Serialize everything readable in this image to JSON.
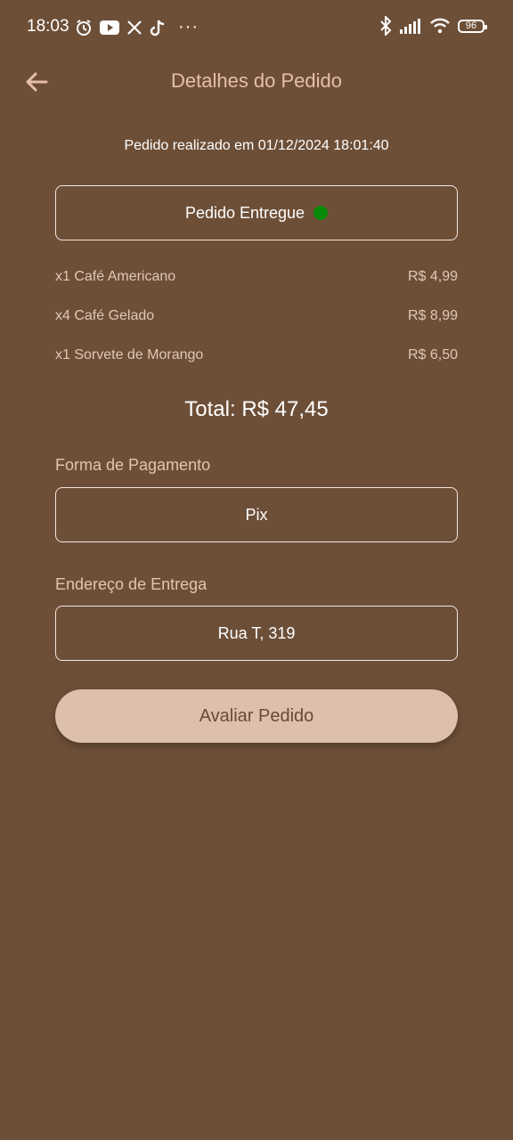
{
  "status_bar": {
    "time": "18:03",
    "left_icons": [
      "alarm-icon",
      "youtube-icon",
      "x-icon",
      "tiktok-icon"
    ],
    "more": "···",
    "right_icons": [
      "bluetooth-icon",
      "signal-icon",
      "wifi-icon"
    ],
    "battery": "96"
  },
  "header": {
    "title": "Detalhes do Pedido",
    "back_icon": "arrow-left-icon"
  },
  "order": {
    "date_text": "Pedido realizado em 01/12/2024 18:01:40",
    "status": "Pedido Entregue",
    "status_color": "#0a8a0a",
    "items": [
      {
        "label": "x1 Café Americano",
        "price": "R$ 4,99"
      },
      {
        "label": "x4 Café Gelado",
        "price": "R$ 8,99"
      },
      {
        "label": "x1 Sorvete de Morango",
        "price": "R$ 6,50"
      }
    ],
    "total": "Total: R$ 47,45"
  },
  "payment": {
    "label": "Forma de Pagamento",
    "value": "Pix"
  },
  "address": {
    "label": "Endereço de Entrega",
    "value": "Rua T, 319"
  },
  "actions": {
    "rate_label": "Avaliar Pedido"
  },
  "colors": {
    "background": "#6d4f38",
    "title": "#e6bfa6",
    "button_bg": "#dcc0ad",
    "button_text": "#6b4a34"
  }
}
